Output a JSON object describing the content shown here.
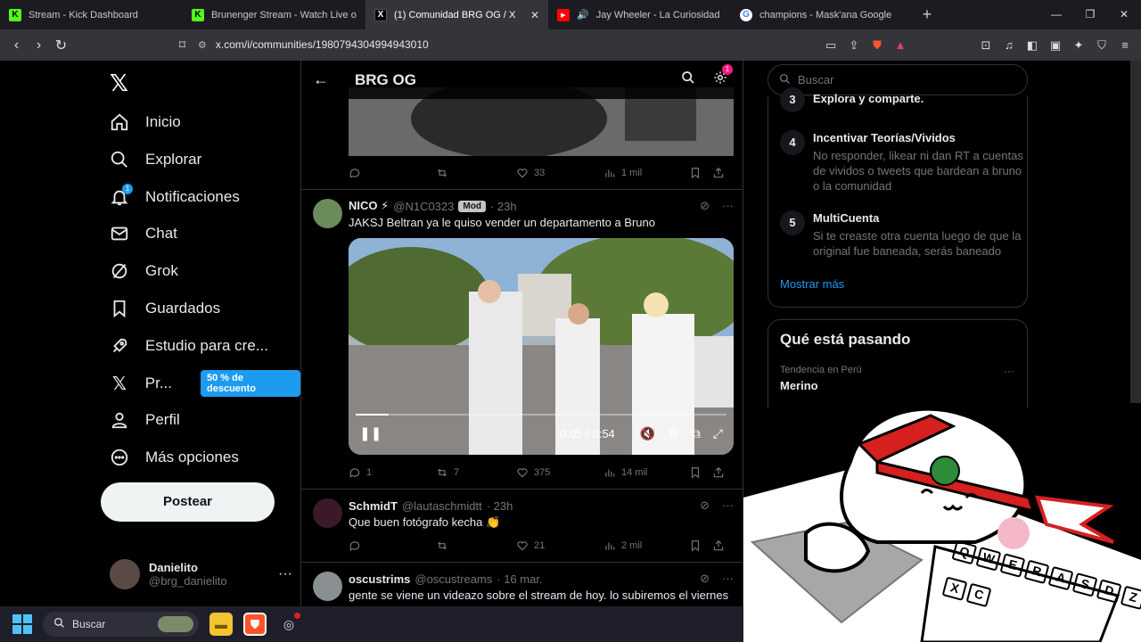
{
  "browser": {
    "tabs": [
      {
        "title": "Stream - Kick Dashboard",
        "fav": "K",
        "fav_bg": "#53fc18",
        "active": false
      },
      {
        "title": "Brunenger Stream - Watch Live on Ki",
        "fav": "K",
        "fav_bg": "#53fc18",
        "active": false
      },
      {
        "title": "(1) Comunidad BRG OG / X",
        "fav": "X",
        "fav_bg": "#000000",
        "active": true
      },
      {
        "title": "Jay Wheeler - La Curiosidad ft. M",
        "fav": "▶",
        "fav_bg": "#ff0000",
        "active": false
      },
      {
        "title": "champions - Mask'ana Google",
        "fav": "G",
        "fav_bg": "#ffffff",
        "active": false
      }
    ],
    "url": "x.com/i/communities/1980794304994943010"
  },
  "nav": {
    "items": [
      {
        "label": "Inicio",
        "icon": "home-icon"
      },
      {
        "label": "Explorar",
        "icon": "search-icon"
      },
      {
        "label": "Notificaciones",
        "icon": "bell-icon",
        "badge": "1"
      },
      {
        "label": "Chat",
        "icon": "mail-icon"
      },
      {
        "label": "Grok",
        "icon": "grok-icon"
      },
      {
        "label": "Guardados",
        "icon": "bookmark-icon"
      },
      {
        "label": "Estudio para cre...",
        "icon": "rocket-icon"
      },
      {
        "label": "Pr...",
        "icon": "x-icon",
        "promo": "50 % de descuento"
      },
      {
        "label": "Perfil",
        "icon": "person-icon"
      },
      {
        "label": "Más opciones",
        "icon": "more-icon"
      }
    ],
    "post_button": "Postear",
    "user": {
      "name": "Danielito",
      "handle": "@brg_danielito"
    }
  },
  "community": {
    "title": "BRG OG",
    "settings_badge": "1"
  },
  "posts": [
    {
      "stats": {
        "replies": "",
        "reposts": "",
        "likes": "33",
        "views": "1 mil"
      }
    },
    {
      "name": "NICO ⚡",
      "handle": "@N1C0323",
      "mod": "Mod",
      "time": "· 23h",
      "text": "JAKSJ Beltran ya le quiso vender un departamento a Bruno",
      "video": {
        "time": "0:05 / 0:54",
        "progress": 0.09
      },
      "stats": {
        "replies": "1",
        "reposts": "7",
        "likes": "375",
        "views": "14 mil"
      }
    },
    {
      "name": "SchmidT",
      "handle": "@lautaschmidtt",
      "time": "· 23h",
      "text": "Que buen fotógrafo kecha 👏",
      "stats": {
        "replies": "",
        "reposts": "",
        "likes": "21",
        "views": "2 mil"
      }
    },
    {
      "name": "oscustrims",
      "handle": "@oscustreams",
      "time": "· 16 mar.",
      "text": "gente se viene un videazo sobre el stream de hoy. lo subiremos el viernes"
    }
  ],
  "sidebar": {
    "search_placeholder": "Buscar",
    "rules": [
      {
        "num": "3",
        "title": "Explora y comparte.",
        "desc": ""
      },
      {
        "num": "4",
        "title": "Incentivar Teorías/Vividos",
        "desc": "No responder, likear ni dan RT a cuentas de vividos o tweets que bardean a bruno o la comunidad"
      },
      {
        "num": "5",
        "title": "MultiCuenta",
        "desc": "Si te creaste otra cuenta luego de que la original fue baneada, serás baneado"
      }
    ],
    "show_more": "Mostrar más",
    "trends": {
      "heading": "Qué está pasando",
      "context": "Tendencia en Perú",
      "name": "Merino"
    }
  },
  "overlay": {
    "keyboard_keys": [
      "Q",
      "W",
      "E",
      "R",
      "A",
      "S",
      "D",
      "Z",
      "X",
      "C"
    ]
  },
  "taskbar": {
    "search": "Buscar"
  },
  "colors": {
    "accent": "#1d9bf0",
    "background": "#000000",
    "border": "#2f3336",
    "muted": "#71767b"
  }
}
